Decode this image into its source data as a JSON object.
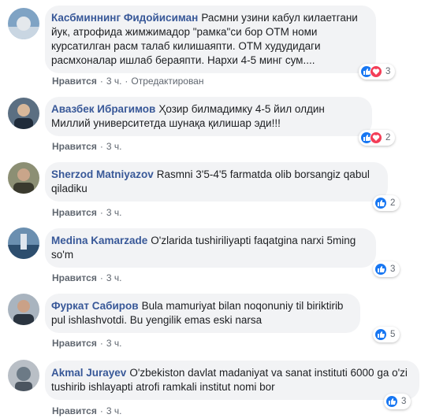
{
  "ui": {
    "like_label": "Нравится",
    "edited_label": "Отредактирован",
    "separator": "·"
  },
  "colors": {
    "author": "#385898",
    "bubble": "#f2f3f5",
    "like_reaction": "#1877f2",
    "love_reaction": "#f33e58"
  },
  "comments": [
    {
      "author": "Касбминнинг Фидойисиман",
      "text": "Расмни узини кабул килаетгани йук, атрофида жимжимадор \"рамка\"си бор ОТМ номи курсатилган расм талаб килишаяпти. ОТМ худудидаги расмхоналар ишлаб бераяпти. Нархи 4-5 минг сум....",
      "time": "3 ч.",
      "reaction_count": "3",
      "reactions": [
        "like-icon",
        "love-icon"
      ]
    },
    {
      "author": "Авазбек Ибрагимов",
      "text": "Ҳозир билмадимку 4-5 йил олдин Миллий университетда шунақа қилишар эди!!!",
      "time": "3 ч.",
      "reaction_count": "2",
      "reactions": [
        "like-icon",
        "love-icon"
      ]
    },
    {
      "author": "Sherzod Matniyazov",
      "text": "Rasmni 3'5-4'5 farmatda olib borsangiz qabul qiladiku",
      "time": "3 ч.",
      "reaction_count": "2",
      "reactions": [
        "like-icon"
      ]
    },
    {
      "author": "Medina Kamarzade",
      "text": "O'zlarida tushiriliyapti faqatgina narxi 5ming so'm",
      "time": "3 ч.",
      "reaction_count": "3",
      "reactions": [
        "like-icon"
      ]
    },
    {
      "author": "Фуркат Сабиров",
      "text": "Bula mamuriyat bilan noqonuniy til biriktirib pul ishlashvotdi. Bu yengilik emas eski narsa",
      "time": "3 ч.",
      "reaction_count": "5",
      "reactions": [
        "like-icon"
      ]
    },
    {
      "author": "Akmal Jurayev",
      "text": "O'zbekiston davlat madaniyat va sanat instituti 6000 ga o'zi tushirib ishlayapti atrofi ramkali institut nomi bor",
      "time": "3 ч.",
      "reaction_count": "3",
      "reactions": [
        "like-icon"
      ]
    }
  ]
}
